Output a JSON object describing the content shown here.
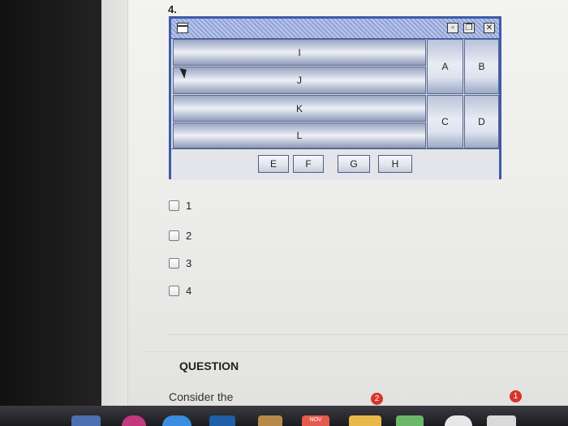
{
  "question_number": "4.",
  "window": {
    "center_buttons": [
      "I",
      "J",
      "K",
      "L"
    ],
    "side_buttons": [
      "A",
      "B",
      "C",
      "D"
    ],
    "south_buttons": [
      "E",
      "F",
      "G",
      "H"
    ],
    "title_controls": [
      "minimize-icon",
      "restore-icon",
      "close-icon"
    ]
  },
  "options": [
    "1",
    "2",
    "3",
    "4"
  ],
  "next_question": {
    "heading": "QUESTION",
    "text": "Consider the"
  },
  "dock": {
    "calendar_label": "NOV",
    "badges": [
      "2",
      "1"
    ]
  }
}
